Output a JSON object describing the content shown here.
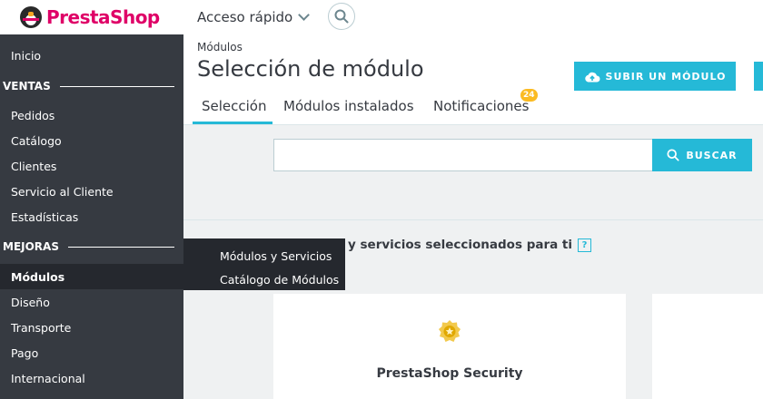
{
  "brand": {
    "name": "PrestaShop"
  },
  "topbar": {
    "quick_access": "Acceso rápido"
  },
  "sidebar": {
    "items_top": [
      {
        "label": "Inicio"
      }
    ],
    "sections": [
      {
        "label": "VENTAS",
        "items": [
          {
            "label": "Pedidos"
          },
          {
            "label": "Catálogo"
          },
          {
            "label": "Clientes"
          },
          {
            "label": "Servicio al Cliente"
          },
          {
            "label": "Estadísticas"
          }
        ]
      },
      {
        "label": "MEJORAS",
        "items": [
          {
            "label": "Módulos"
          },
          {
            "label": "Diseño"
          },
          {
            "label": "Transporte"
          },
          {
            "label": "Pago"
          },
          {
            "label": "Internacional"
          }
        ]
      }
    ],
    "flyout": [
      {
        "label": "Módulos y Servicios"
      },
      {
        "label": "Catálogo de Módulos"
      }
    ]
  },
  "header": {
    "breadcrumb": "Módulos",
    "title": "Selección de módulo",
    "upload_button": "SUBIR UN MÓDULO",
    "tabs": [
      {
        "label": "Selección"
      },
      {
        "label": "Módulos instalados"
      },
      {
        "label": "Notificaciones"
      }
    ],
    "notifications_badge": "24"
  },
  "content": {
    "search": {
      "placeholder": "",
      "button": "BUSCAR"
    },
    "section_title": "y servicios seleccionados para ti",
    "help": "?",
    "cards": [
      {
        "title": "PrestaShop Security"
      }
    ]
  },
  "colors": {
    "accent": "#25b9d7",
    "brand": "#df0067",
    "sidebar": "#363a41",
    "badge": "#fbbb22"
  }
}
